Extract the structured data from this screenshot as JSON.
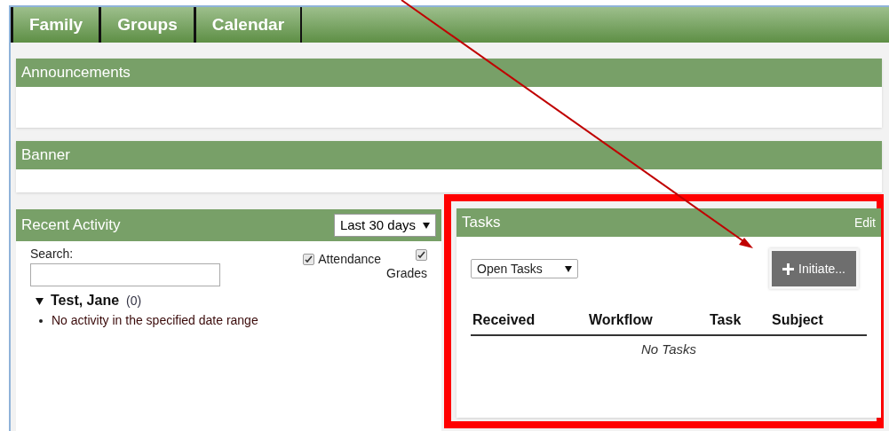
{
  "tabs": [
    {
      "label": "Family",
      "selected": false
    },
    {
      "label": "Groups",
      "selected": false
    },
    {
      "label": "Calendar",
      "selected": false
    }
  ],
  "announcements": {
    "title": "Announcements"
  },
  "banner": {
    "title": "Banner"
  },
  "recent_activity": {
    "title": "Recent Activity",
    "range": "Last 30 days",
    "search_label": "Search:",
    "filters": [
      {
        "label": "Attendance",
        "checked": true
      },
      {
        "label": "Grades",
        "checked": true
      }
    ],
    "people": [
      {
        "name": "Test, Jane",
        "count": "(0)",
        "expanded": true,
        "items": [
          "No activity in the specified date range"
        ]
      }
    ]
  },
  "tasks": {
    "title": "Tasks",
    "edit": "Edit",
    "filter": "Open Tasks",
    "initiate": "Initiate...",
    "columns": [
      "Received",
      "Workflow",
      "Task",
      "Subject"
    ],
    "empty": "No Tasks"
  }
}
